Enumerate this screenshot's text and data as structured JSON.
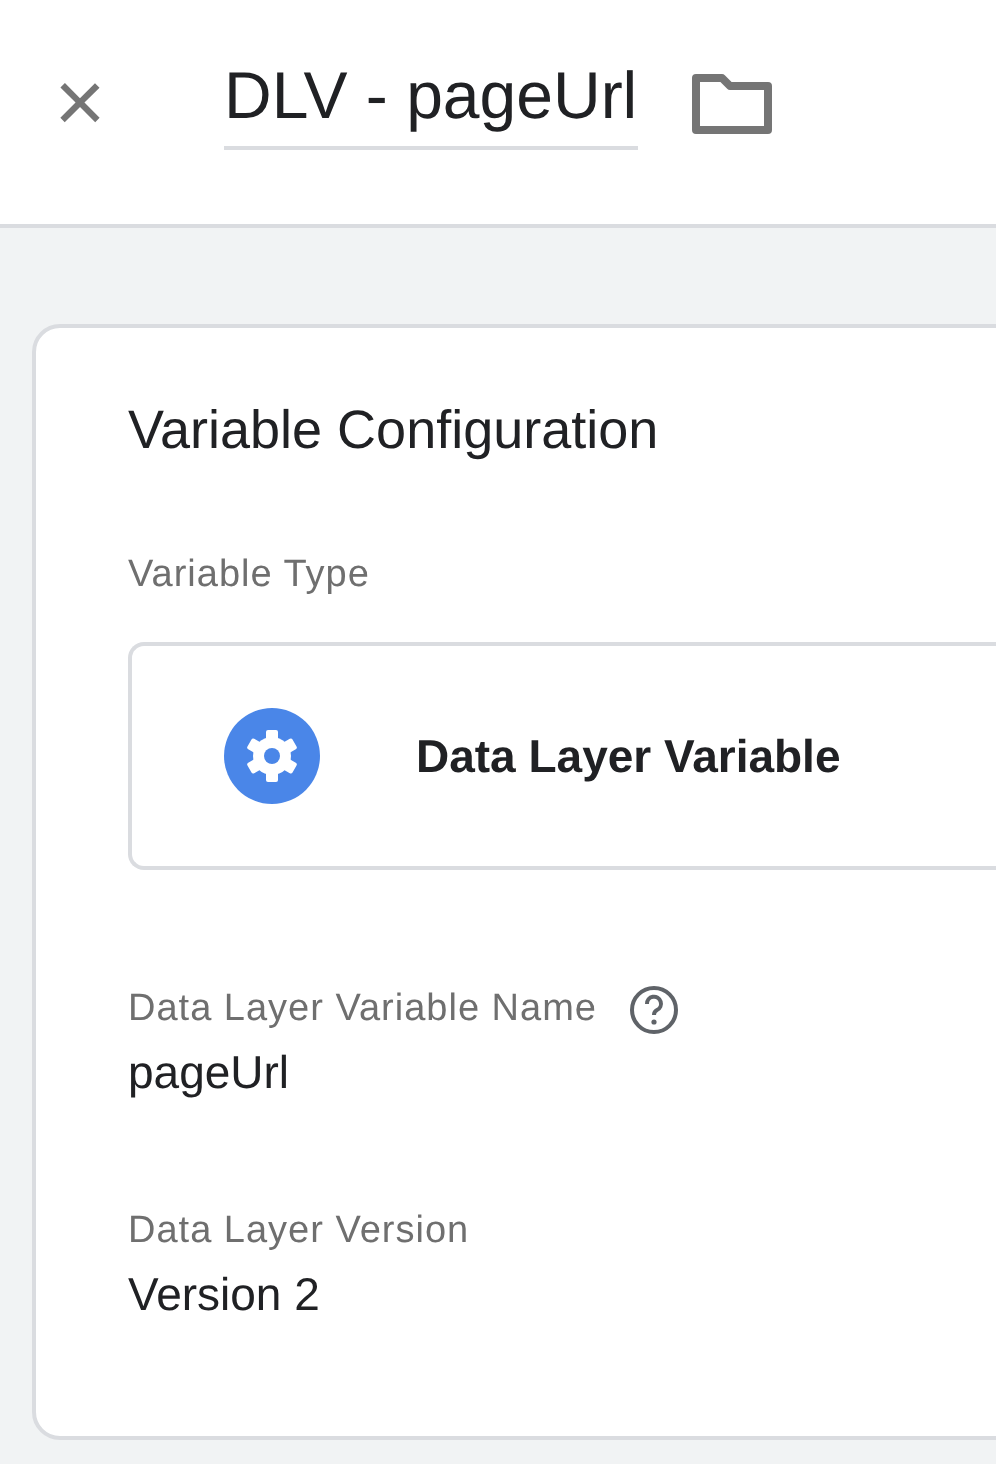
{
  "header": {
    "close": "×",
    "title": "DLV - pageUrl"
  },
  "card": {
    "title": "Variable Configuration",
    "variable_type": {
      "label": "Variable Type",
      "value": "Data Layer Variable"
    },
    "fields": [
      {
        "label": "Data Layer Variable Name",
        "help": true,
        "value": "pageUrl"
      },
      {
        "label": "Data Layer Version",
        "help": false,
        "value": "Version 2"
      }
    ]
  }
}
